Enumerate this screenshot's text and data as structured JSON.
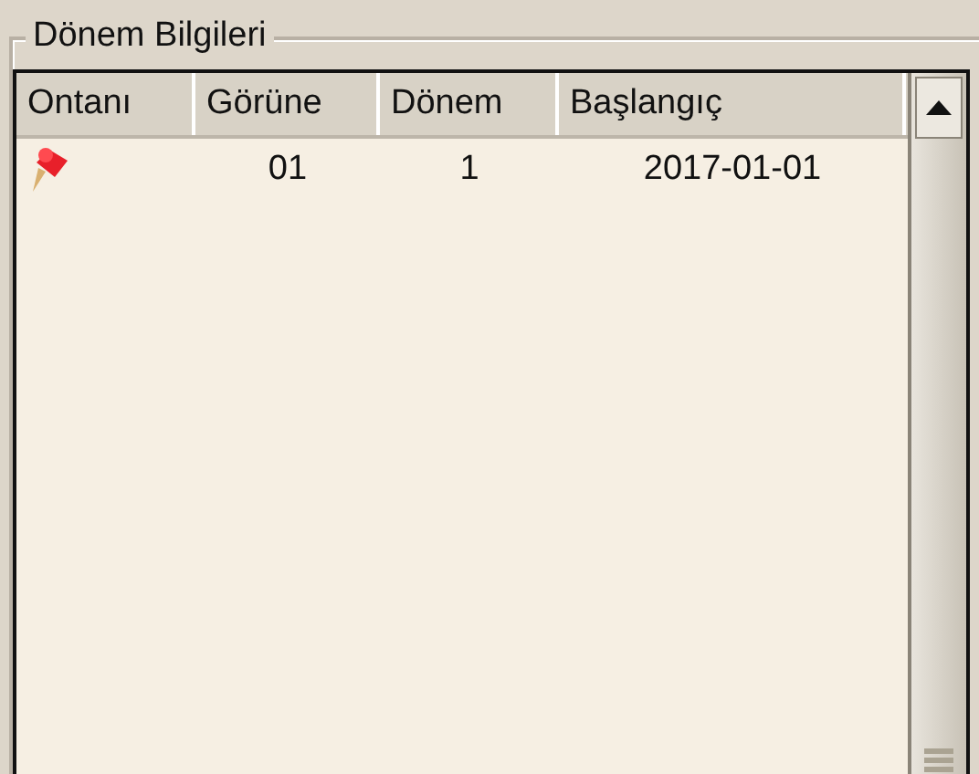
{
  "group": {
    "title": "Dönem Bilgileri"
  },
  "table": {
    "columns": [
      "Ontanı",
      "Görüne",
      "Dönem",
      "Başlangıç"
    ],
    "rows": [
      {
        "default": true,
        "cells": [
          "",
          "01",
          "1",
          "2017-01-01"
        ]
      }
    ]
  }
}
